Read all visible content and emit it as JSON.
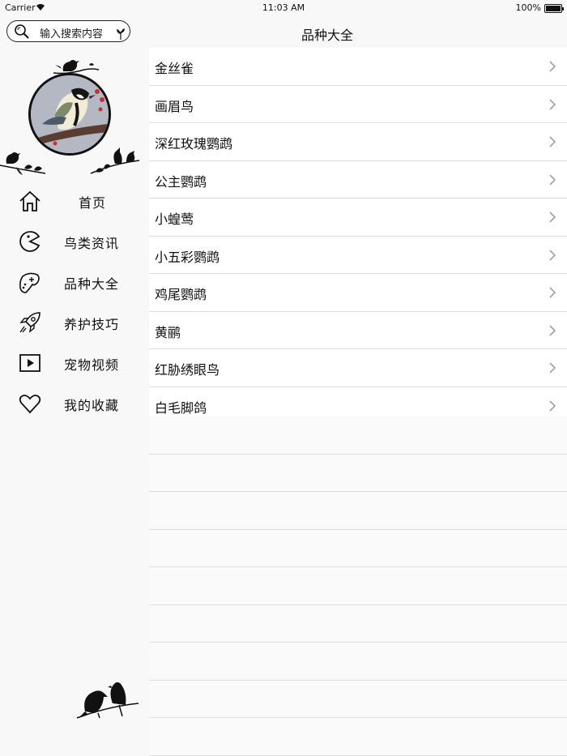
{
  "status": {
    "carrier": "Carrier",
    "time": "11:03 AM",
    "battery": "100%"
  },
  "search": {
    "placeholder": "输入搜索内容"
  },
  "header": {
    "title": "品种大全"
  },
  "menu": [
    {
      "label": "首页",
      "icon": "home-icon"
    },
    {
      "label": "鸟类资讯",
      "icon": "pacman-icon"
    },
    {
      "label": "品种大全",
      "icon": "gamepad-icon"
    },
    {
      "label": "养护技巧",
      "icon": "rocket-icon"
    },
    {
      "label": "宠物视频",
      "icon": "video-play-icon"
    },
    {
      "label": "我的收藏",
      "icon": "heart-icon"
    }
  ],
  "species": [
    "金丝雀",
    "画眉鸟",
    "深红玫瑰鹦鹉",
    "公主鹦鹉",
    "小蝗莺",
    "小五彩鹦鹉",
    "鸡尾鹦鹉",
    "黄鹂",
    "红胁绣眼鸟",
    "白毛脚鸽"
  ],
  "colors": {
    "accent": "#111111",
    "separator": "#dedede",
    "chevron": "#a0a0a0"
  }
}
